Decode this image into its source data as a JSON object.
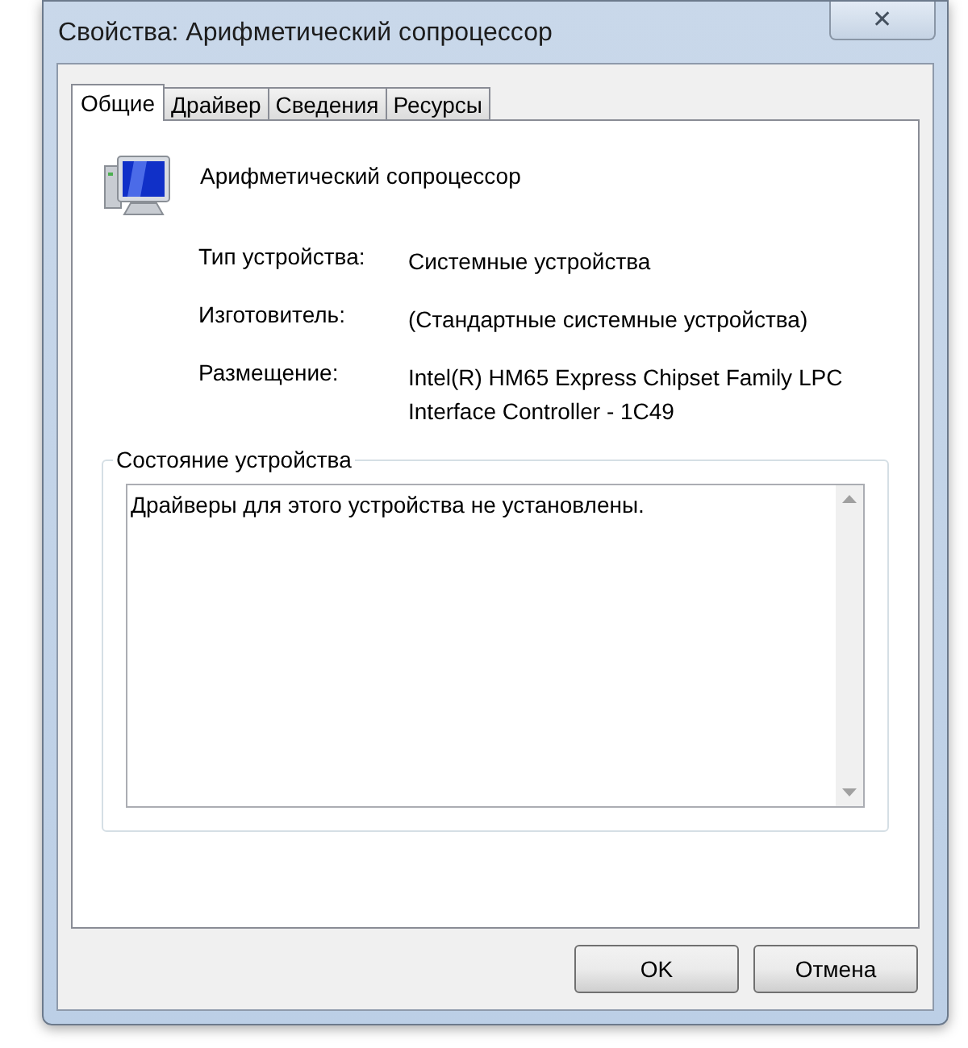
{
  "window": {
    "title": "Свойства: Арифметический сопроцессор",
    "close": "✕"
  },
  "tabs": [
    {
      "label": "Общие",
      "selected": true
    },
    {
      "label": "Драйвер",
      "selected": false
    },
    {
      "label": "Сведения",
      "selected": false
    },
    {
      "label": "Ресурсы",
      "selected": false
    }
  ],
  "device": {
    "name": "Арифметический сопроцессор"
  },
  "properties": [
    {
      "label": "Тип устройства:",
      "value": [
        "Системные устройства"
      ]
    },
    {
      "label": "Изготовитель:",
      "value": [
        "(Стандартные системные устройства)"
      ]
    },
    {
      "label": "Размещение:",
      "value": [
        "Intel(R) HM65 Express Chipset Family LPC",
        "Interface Controller - 1C49"
      ]
    }
  ],
  "status": {
    "title": "Состояние устройства",
    "text": "Драйверы для этого устройства не установлены."
  },
  "buttons": [
    "OK",
    "Отмена"
  ]
}
